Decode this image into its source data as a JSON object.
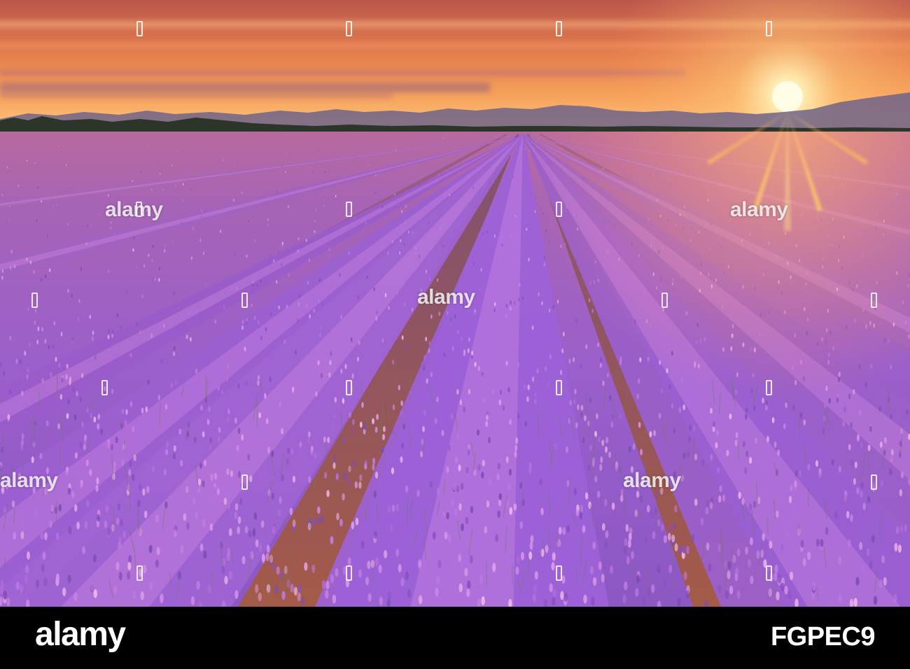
{
  "scene": {
    "description_label": "",
    "colors": {
      "sky_top": "#c6614f",
      "sky_mid": "#f08a4e",
      "sky_horizon": "#ffc27a",
      "sun": "#fff6c9",
      "mountains": "#6a5f86",
      "treeline": "#2f3a2c",
      "lavender_far": "#b0659e",
      "lavender_mid": "#a565c8",
      "lavender_near": "#9b62d6",
      "lavender_highlight": "#e7a3e6",
      "soil": "#a55e3d",
      "footer_bg": "#000000",
      "footer_text": "#ffffff"
    }
  },
  "watermark": {
    "word": "alamy"
  },
  "footer": {
    "brand": "alamy",
    "image_id": "FGPEC9"
  }
}
